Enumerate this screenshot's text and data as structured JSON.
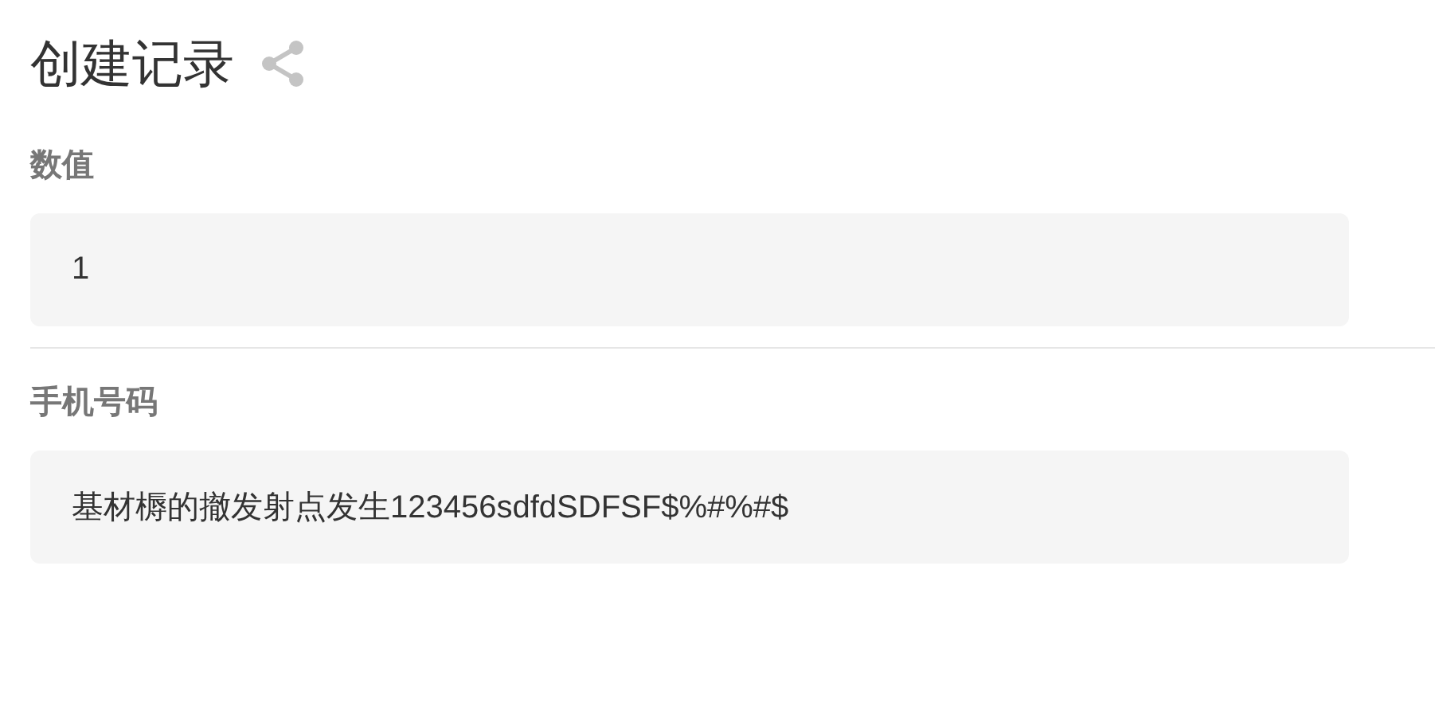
{
  "title": "创建记录",
  "fields": [
    {
      "label": "数值",
      "value": "1"
    },
    {
      "label": "手机号码",
      "value": "基材槈的撤发射点发生123456sdfdSDFSF$%#%#$"
    }
  ]
}
